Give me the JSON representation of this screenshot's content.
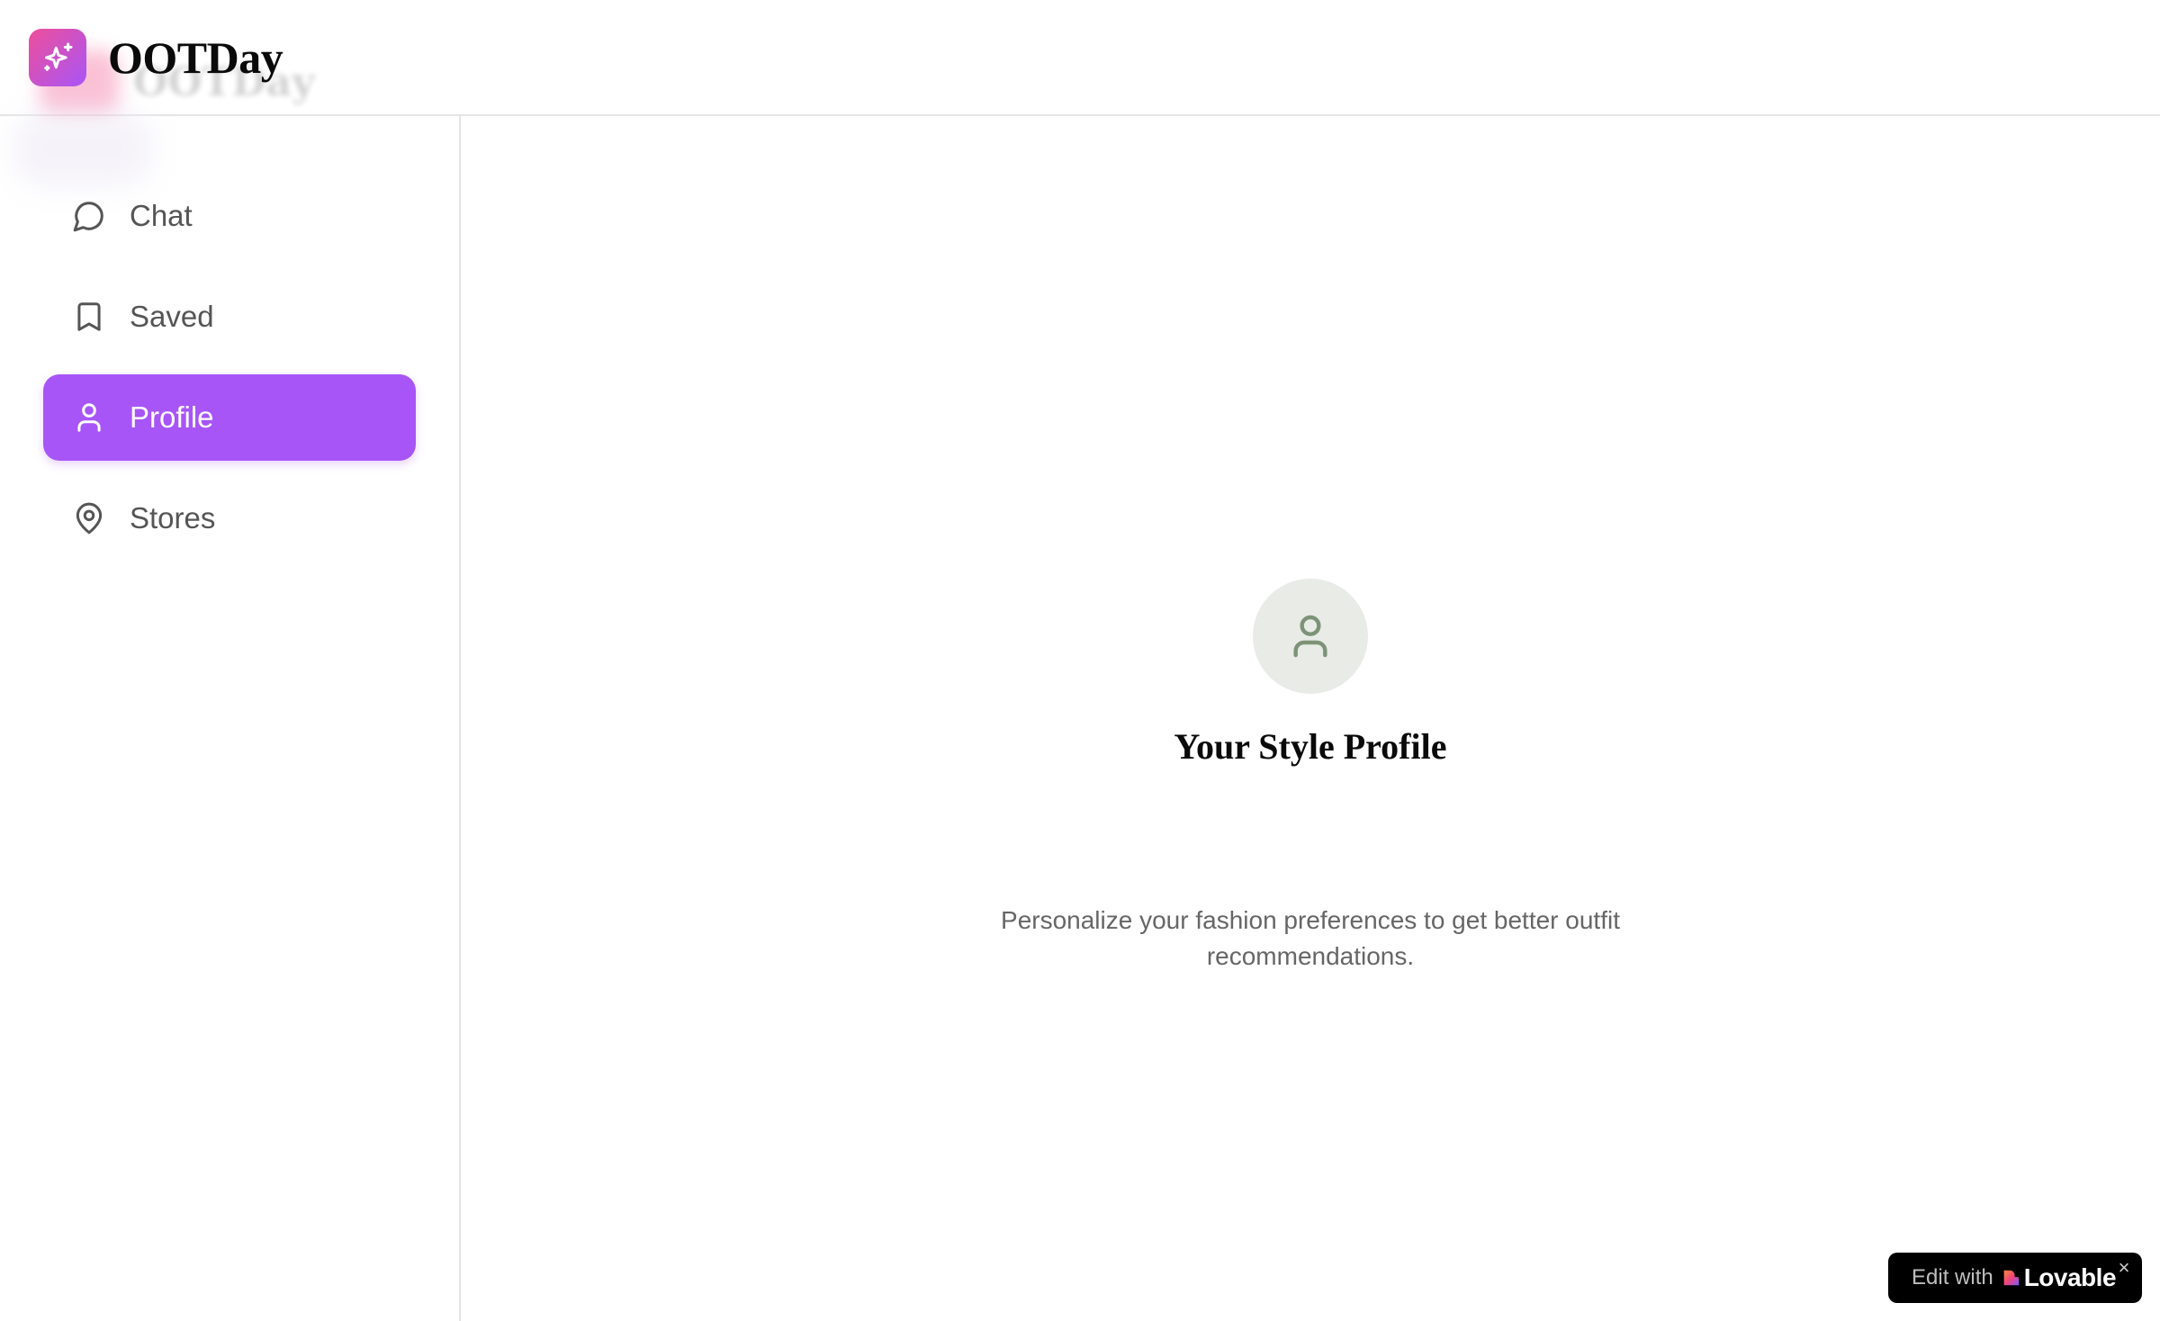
{
  "app": {
    "title": "OOTDay",
    "logo_icon": "sparkles-icon",
    "brand_gradient": [
      "#ee4f9a",
      "#a855f7"
    ]
  },
  "sidebar": {
    "items": [
      {
        "label": "Chat",
        "icon": "message-circle-icon",
        "active": false
      },
      {
        "label": "Saved",
        "icon": "bookmark-icon",
        "active": false
      },
      {
        "label": "Profile",
        "icon": "user-icon",
        "active": true
      },
      {
        "label": "Stores",
        "icon": "map-pin-icon",
        "active": false
      }
    ],
    "active_color": "#a855f7"
  },
  "main": {
    "icon": "user-icon",
    "title": "Your Style Profile",
    "description": "Personalize your fashion preferences to get better outfit recommendations."
  },
  "badge": {
    "prefix": "Edit with",
    "brand": "Lovable",
    "close": "×"
  }
}
